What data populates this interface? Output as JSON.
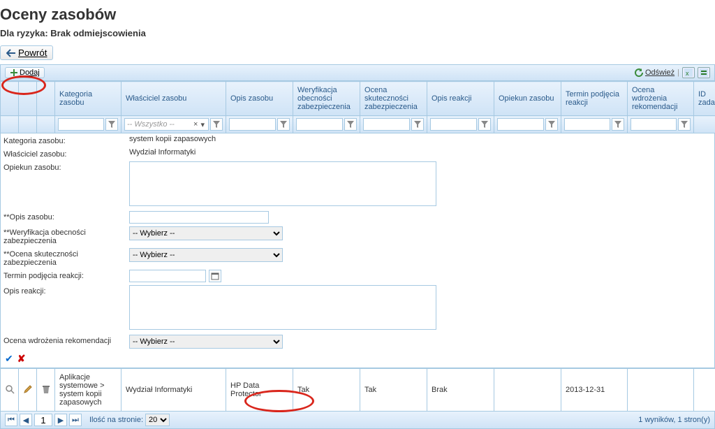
{
  "page": {
    "title": "Oceny zasobów",
    "subtitle": "Dla ryzyka: Brak odmiejscowienia",
    "back": "Powrót"
  },
  "toolbar": {
    "add": "Dodaj",
    "refresh": "Odśwież"
  },
  "columns": {
    "c1": "Kategoria zasobu",
    "c2": "Właściciel zasobu",
    "c3": "Opis zasobu",
    "c4": "Weryfikacja obecności zabezpieczenia",
    "c5": "Ocena skuteczności zabezpieczenia",
    "c6": "Opis reakcji",
    "c7": "Opiekun zasobu",
    "c8": "Termin podjęcia reakcji",
    "c9": "Ocena wdrożenia rekomendacji",
    "c10": "ID zadania"
  },
  "filter": {
    "ownerPlaceholder": "-- Wszystko --"
  },
  "form": {
    "kategoria_lbl": "Kategoria zasobu:",
    "kategoria_val": "system kopii zapasowych",
    "wlasciciel_lbl": "Właściciel zasobu:",
    "wlasciciel_val": "Wydział Informatyki",
    "opiekun_lbl": "Opiekun zasobu:",
    "opis_lbl": "**Opis zasobu:",
    "weryf_lbl": "**Weryfikacja obecności zabezpieczenia",
    "ocena_sk_lbl": "**Ocena skuteczności zabezpieczenia",
    "termin_lbl": "Termin podjęcia reakcji:",
    "opis_reakcji_lbl": "Opis reakcji:",
    "ocena_wdr_lbl": "Ocena wdrożenia rekomendacji",
    "select_ph": "-- Wybierz --"
  },
  "row": {
    "kategoria": "Aplikacje systemowe > system kopii zapasowych",
    "wlasciciel": "Wydział Informatyki",
    "opis": "HP Data Protector",
    "weryf": "Tak",
    "ocena_sk": "Tak",
    "opis_reakcji": "Brak",
    "opiekun": "",
    "termin": "2013-12-31",
    "ocena_wdr": "",
    "id": ""
  },
  "pager": {
    "page": "1",
    "perpage_lbl": "Ilość na stronie:",
    "perpage": "20",
    "summary": "1 wyników, 1 stron(y)"
  }
}
